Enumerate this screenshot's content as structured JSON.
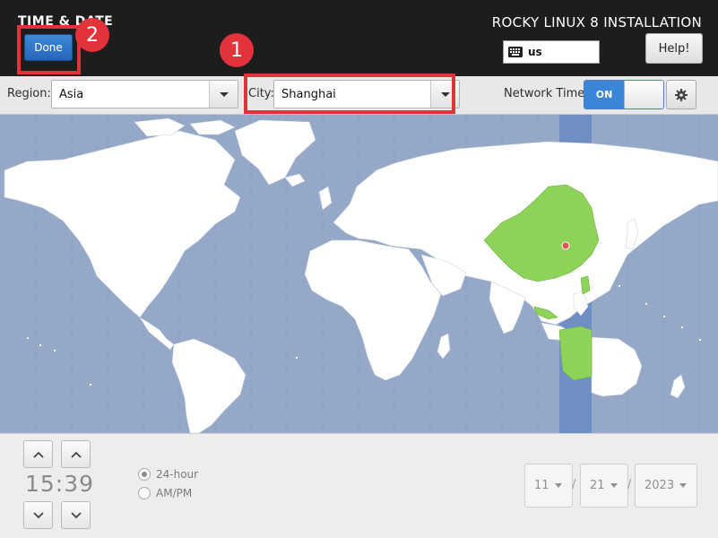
{
  "header": {
    "title": "TIME & DATE",
    "product": "ROCKY LINUX 8 INSTALLATION",
    "done_label": "Done",
    "keyboard_layout": "us",
    "help_label": "Help!"
  },
  "annotations": [
    {
      "number": "1",
      "target": "city"
    },
    {
      "number": "2",
      "target": "done"
    }
  ],
  "toolbar": {
    "region_label": "Region:",
    "region_value": "Asia",
    "city_label": "City:",
    "city_value": "Shanghai",
    "network_time_label": "Network Time",
    "network_time_state": "ON"
  },
  "map": {
    "selected_timezone": "Asia/Shanghai",
    "land_color": "#ffffff",
    "ocean_color": "#96a8c8",
    "highlight_color": "#8dd35a",
    "timezone_band_color": "#6f8fc4",
    "marker_color": "#e05050"
  },
  "time": {
    "value": "15:39",
    "format_24h_label": "24-hour",
    "format_ampm_label": "AM/PM",
    "selected_format": "24-hour"
  },
  "date": {
    "month": "11",
    "day": "21",
    "year": "2023",
    "separator": "/"
  }
}
